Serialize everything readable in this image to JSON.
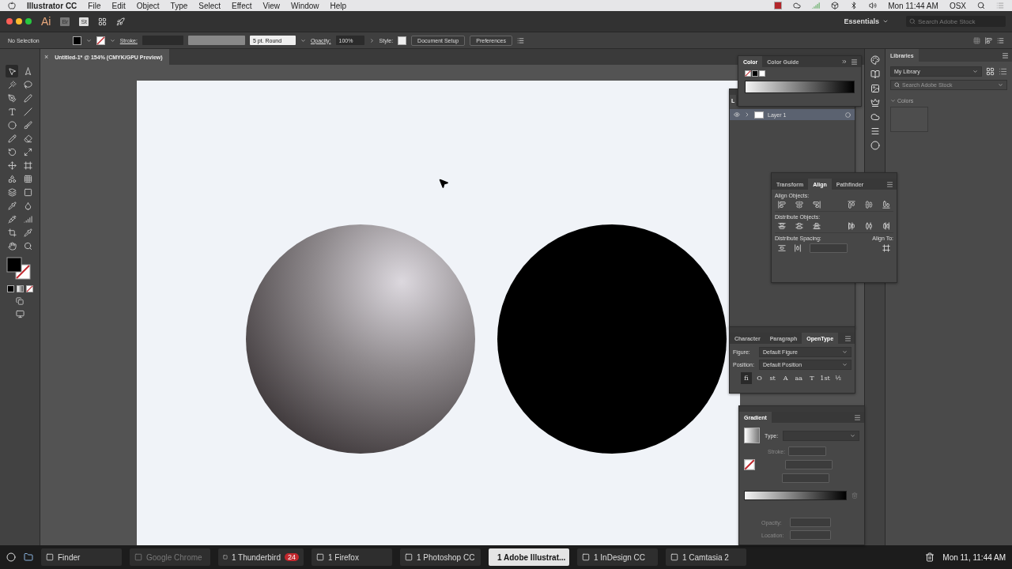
{
  "menubar": {
    "app_name": "Illustrator CC",
    "menus": [
      "File",
      "Edit",
      "Object",
      "Type",
      "Select",
      "Effect",
      "View",
      "Window",
      "Help"
    ],
    "clock": "Mon 11:44 AM",
    "user": "OSX"
  },
  "app_bar": {
    "logo": "Ai",
    "bridge": "Br",
    "stock": "St",
    "workspace": "Essentials",
    "search_placeholder": "Search Adobe Stock"
  },
  "control_bar": {
    "selection": "No Selection",
    "stroke_label": "Stroke:",
    "brush": "5 pt. Round",
    "opacity_label": "Opacity:",
    "opacity": "100%",
    "style_label": "Style:",
    "buttons": [
      "Document Setup",
      "Preferences"
    ]
  },
  "tools": [
    {
      "kind": "select",
      "selected": true
    },
    {
      "kind": "direct",
      "selected": false
    },
    {
      "kind": "wand",
      "selected": false
    },
    {
      "kind": "lasso",
      "selected": false
    },
    {
      "kind": "pen",
      "selected": false
    },
    {
      "kind": "curvature",
      "selected": false
    },
    {
      "kind": "type",
      "selected": false
    },
    {
      "kind": "line",
      "selected": false
    },
    {
      "kind": "ellipse",
      "selected": false
    },
    {
      "kind": "brush",
      "selected": false
    },
    {
      "kind": "pencil",
      "selected": false
    },
    {
      "kind": "eraser",
      "selected": false
    },
    {
      "kind": "rotate",
      "selected": false
    },
    {
      "kind": "scale",
      "selected": false
    },
    {
      "kind": "move",
      "selected": false
    },
    {
      "kind": "transform",
      "selected": false
    },
    {
      "kind": "builder",
      "selected": false
    },
    {
      "kind": "perspective",
      "selected": false
    },
    {
      "kind": "mesh",
      "selected": false
    },
    {
      "kind": "gradient",
      "selected": false
    },
    {
      "kind": "eyedropper",
      "selected": false
    },
    {
      "kind": "blend",
      "selected": false
    },
    {
      "kind": "sprayer",
      "selected": false
    },
    {
      "kind": "graph",
      "selected": false
    },
    {
      "kind": "artboard",
      "selected": false
    },
    {
      "kind": "slice",
      "selected": false
    },
    {
      "kind": "hand",
      "selected": false
    },
    {
      "kind": "zoom",
      "selected": false
    }
  ],
  "document": {
    "tab": "Untitled-1* @ 154% (CMYK/GPU Preview)",
    "close": "×"
  },
  "color_panel": {
    "tabs": [
      {
        "label": "Color",
        "selected": true
      },
      {
        "label": "Color Guide",
        "selected": false
      }
    ]
  },
  "layers_panel": {
    "tab": "L",
    "layers": [
      {
        "name": "Layer 1",
        "visible": true
      }
    ]
  },
  "align_panel": {
    "tabs": [
      {
        "label": "Transform",
        "selected": false
      },
      {
        "label": "Align",
        "selected": true
      },
      {
        "label": "Pathfinder",
        "selected": false
      }
    ],
    "sections": [
      "Align Objects:",
      "Distribute Objects:",
      "Distribute Spacing:"
    ],
    "align_to": "Align To:"
  },
  "type_panel": {
    "tabs": [
      {
        "label": "Character",
        "selected": false
      },
      {
        "label": "Paragraph",
        "selected": false
      },
      {
        "label": "OpenType",
        "selected": true
      }
    ],
    "fields": [
      {
        "label": "Figure:",
        "value": "Default Figure"
      },
      {
        "label": "Position:",
        "value": "Default Position"
      }
    ],
    "glyphs": [
      {
        "label": "fi",
        "selected": true
      },
      {
        "label": "O",
        "selected": false
      },
      {
        "label": "st",
        "selected": false
      },
      {
        "label": "A",
        "selected": false
      },
      {
        "label": "aa",
        "selected": false
      },
      {
        "label": "T",
        "selected": false
      },
      {
        "label": "1st",
        "selected": false
      },
      {
        "label": "½",
        "selected": false
      }
    ]
  },
  "gradient_panel": {
    "tab": "Gradient",
    "type_label": "Type:",
    "stroke_label": "Stroke:",
    "opacity_label": "Opacity:",
    "location_label": "Location:"
  },
  "libraries": {
    "title": "Libraries",
    "library": "My Library",
    "search_placeholder": "Search Adobe Stock",
    "section": "Colors",
    "section_expanded": true
  },
  "taskbar": {
    "items": [
      {
        "label": "Finder",
        "selected": false,
        "disabled": false
      },
      {
        "label": "Google Chrome",
        "selected": false,
        "disabled": true
      },
      {
        "label": "1 Thunderbird",
        "selected": false,
        "disabled": false,
        "badge": "24"
      },
      {
        "label": "1 Firefox",
        "selected": false,
        "disabled": false
      },
      {
        "label": "1 Photoshop CC",
        "selected": false,
        "disabled": false
      },
      {
        "label": "1 Adobe Illustrat...",
        "selected": true,
        "disabled": false
      },
      {
        "label": "1 InDesign CC",
        "selected": false,
        "disabled": false
      },
      {
        "label": "1 Camtasia 2",
        "selected": false,
        "disabled": false
      }
    ],
    "clock": "Mon 11, 11:44 AM"
  }
}
